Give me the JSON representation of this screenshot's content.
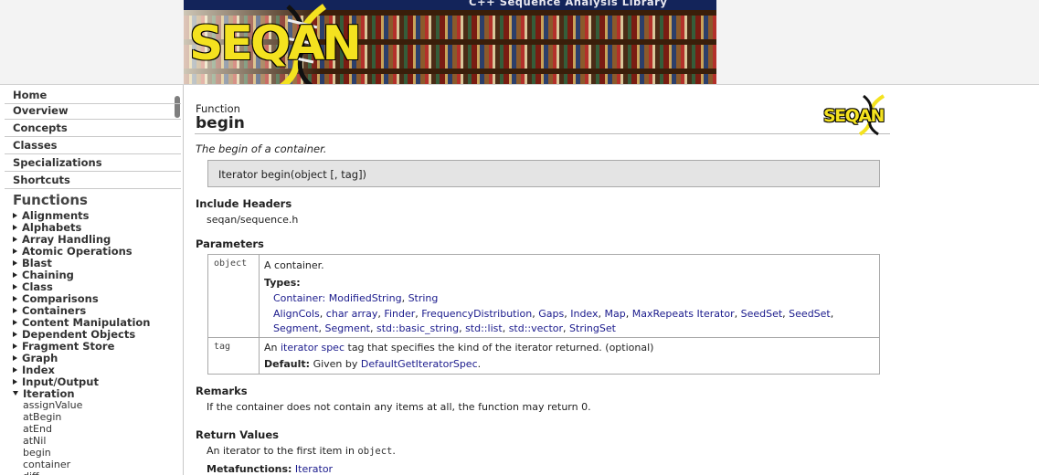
{
  "banner": {
    "strip_text": "C++ Sequence Analysis Library",
    "logo_text": "SEQAN",
    "colors": {
      "strip": "#13245a",
      "logo_yellow": "#f4e21f"
    }
  },
  "sidebar": {
    "nav": [
      "Home",
      "Overview",
      "Concepts",
      "Classes",
      "Specializations",
      "Shortcuts"
    ],
    "heading": "Functions",
    "categories": [
      "Alignments",
      "Alphabets",
      "Array Handling",
      "Atomic Operations",
      "Blast",
      "Chaining",
      "Class",
      "Comparisons",
      "Containers",
      "Content Manipulation",
      "Dependent Objects",
      "Fragment Store",
      "Graph",
      "Index",
      "Input/Output",
      "Iteration"
    ],
    "expanded_items": [
      "assignValue",
      "atBegin",
      "atEnd",
      "atNil",
      "begin",
      "container",
      "diff"
    ]
  },
  "page": {
    "kind": "Function",
    "name": "begin",
    "logo_text": "SEQAN",
    "description": "The begin of a container.",
    "signature": "Iterator begin(object [, tag])",
    "include_heading": "Include Headers",
    "include_value": "seqan/sequence.h",
    "params_heading": "Parameters",
    "params": {
      "object": {
        "name": "object",
        "text": "A container.",
        "types_label": "Types:",
        "line1_prefix": "Container:",
        "line1_links": [
          "ModifiedString",
          "String"
        ],
        "line2_links": [
          "AlignCols",
          "char array",
          "Finder",
          "FrequencyDistribution",
          "Gaps",
          "Index",
          "Map",
          "MaxRepeats Iterator",
          "SeedSet",
          "SeedSet"
        ],
        "line3_links": [
          "Segment",
          "Segment",
          "std::basic_string",
          "std::list",
          "std::vector",
          "StringSet"
        ]
      },
      "tag": {
        "name": "tag",
        "text_pre": "An",
        "link": "iterator spec",
        "text_post": "tag that specifies the kind of the iterator returned. (optional)",
        "default_label": "Default:",
        "default_pre": "Given by",
        "default_link": "DefaultGetIteratorSpec",
        "default_post": "."
      }
    },
    "remarks_heading": "Remarks",
    "remarks_text": "If the container does not contain any items at all, the function may return 0.",
    "return_heading": "Return Values",
    "return_pre": "An iterator to the first item in",
    "return_code": "object",
    "return_post": ".",
    "metafunctions_label": "Metafunctions:",
    "metafunctions_link": "Iterator"
  }
}
